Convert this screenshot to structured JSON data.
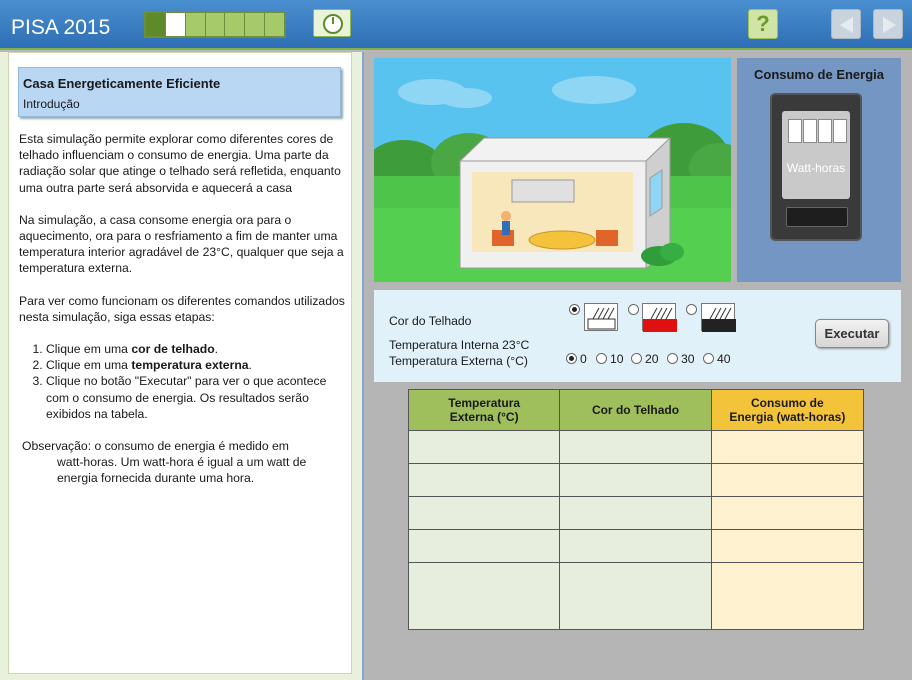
{
  "header": {
    "app_title": "PISA 2015",
    "progress": {
      "total_segments": 7,
      "completed": 1,
      "current": 2
    },
    "help_label": "?"
  },
  "intro": {
    "title": "Casa Energeticamente Eficiente",
    "subtitle": "Introdução"
  },
  "left_text": {
    "p1": "Esta simulação permite explorar como diferentes cores de telhado influenciam o consumo de energia. Uma parte da radiação solar que atinge o telhado será refletida, enquanto uma outra parte será absorvida e aquecerá a casa",
    "p2": "Na simulação, a casa consome energia ora para o aquecimento, ora para o resfriamento a fim de manter uma temperatura interior agradável de 23°C, qualquer que seja a temperatura externa.",
    "p3": "Para ver como funcionam os diferentes comandos utilizados nesta simulação, siga essas etapas:",
    "steps": [
      {
        "pre": "Clique em uma ",
        "bold": "cor de telhado",
        "post": "."
      },
      {
        "pre": "Clique em uma ",
        "bold": "temperatura externa",
        "post": "."
      },
      {
        "pre": "Clique no botão \"Executar\" para ver o que acontece com o consumo de energia. Os resultados serão exibidos na tabela.",
        "bold": "",
        "post": ""
      }
    ],
    "obs_first": "Observação: o consumo de energia é medido em",
    "obs_rest": "watt-horas. Um watt-hora é igual a um watt de energia fornecida durante uma hora."
  },
  "meter": {
    "title": "Consumo de Energia",
    "unit_label": "Watt-horas"
  },
  "controls": {
    "roof_label": "Cor do Telhado",
    "internal_temp": "Temperatura Interna 23°C",
    "external_label": "Temperatura Externa (°C)",
    "roof_options": [
      {
        "name": "white",
        "color": "#ffffff",
        "checked": true
      },
      {
        "name": "red",
        "color": "#e01010",
        "checked": false
      },
      {
        "name": "black",
        "color": "#222222",
        "checked": false
      }
    ],
    "temp_options": [
      "0",
      "10",
      "20",
      "30",
      "40"
    ],
    "temp_selected": "0",
    "run_label": "Executar"
  },
  "table": {
    "col1": "Temperatura Externa (°C)",
    "col1_a": "Temperatura",
    "col1_b": "Externa (°C)",
    "col2": "Cor do Telhado",
    "col3_a": "Consumo de",
    "col3_b": "Energia (watt-horas)",
    "rows": 5
  },
  "colors": {
    "header_blue": "#2f6fb5",
    "green": "#9fbe5c",
    "orange": "#f3c33a"
  }
}
